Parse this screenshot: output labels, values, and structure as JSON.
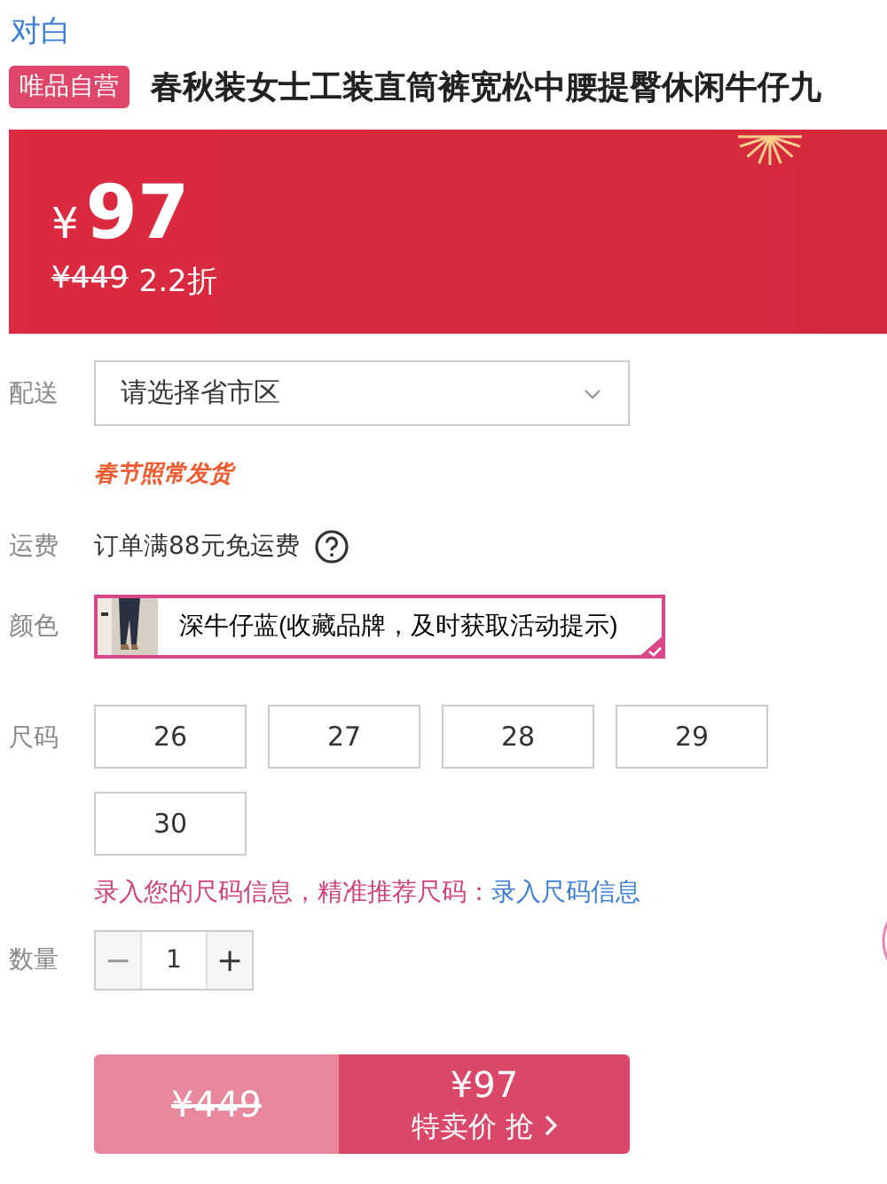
{
  "brand_link": "对白",
  "product": {
    "badge": "唯品自营",
    "title": "春秋装女士工装直筒裤宽松中腰提臀休闲牛仔九"
  },
  "price_banner": {
    "currency": "¥",
    "price": "97",
    "original_price": "¥449",
    "discount": "2.2折"
  },
  "delivery": {
    "label": "配送",
    "placeholder": "请选择省市区",
    "notice": "春节照常发货"
  },
  "shipping": {
    "label": "运费",
    "text": "订单满88元免运费"
  },
  "color": {
    "label": "颜色",
    "options": [
      {
        "name": "深牛仔蓝(收藏品牌，及时获取活动提示)",
        "selected": true
      }
    ]
  },
  "size": {
    "label": "尺码",
    "options": [
      {
        "name": "26",
        "selected": false
      },
      {
        "name": "27",
        "selected": false
      },
      {
        "name": "28",
        "selected": false
      },
      {
        "name": "29",
        "selected": false
      },
      {
        "name": "30",
        "selected": false
      }
    ],
    "hint": "录入您的尺码信息，精准推荐尺码：",
    "hint_link": "录入尺码信息"
  },
  "quantity": {
    "label": "数量",
    "minus": "−",
    "value": "1",
    "plus": "+",
    "minus_disabled": true
  },
  "buy_button": {
    "original_price": "¥449",
    "price": "¥97",
    "action": "特卖价 抢"
  }
}
